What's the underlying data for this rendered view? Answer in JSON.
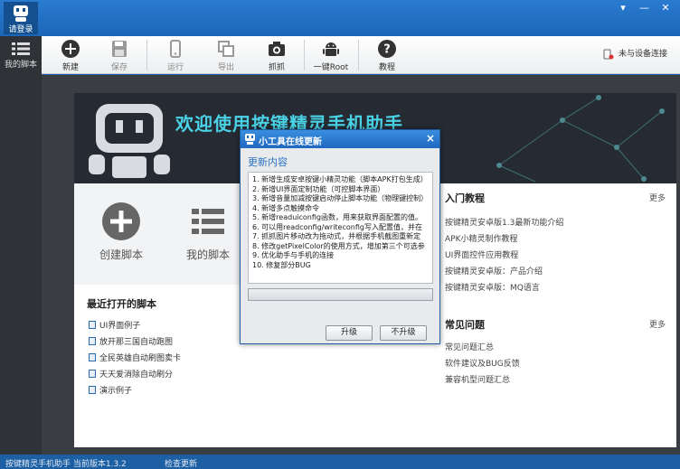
{
  "titlebar": {
    "login_label": "请登录",
    "minimize": "▾",
    "min2": "—",
    "close": "✕"
  },
  "sidebar": {
    "scripts_label": "我的脚本"
  },
  "toolbar": {
    "new": "新建",
    "save": "保存",
    "run": "运行",
    "export": "导出",
    "capture": "抓抓",
    "root": "一键Root",
    "tutorial": "教程",
    "device_status": "未与设备连接"
  },
  "banner": {
    "welcome": "欢迎使用按键精灵手机助手"
  },
  "actions": {
    "create": "创建脚本",
    "mine": "我的脚本"
  },
  "recent": {
    "title": "最近打开的脚本",
    "items": [
      "UI界面例子",
      "放开那三国自动跑图",
      "全民英雄自动刷图卖卡",
      "天天爱消除自动刷分",
      "演示例子"
    ]
  },
  "guide": {
    "title": "入门教程",
    "more": "更多",
    "links": [
      "按键精灵安卓版1.3最新功能介绍",
      "APK小精灵制作教程",
      "UI界面控件应用教程",
      "按键精灵安卓版：产品介绍",
      "按键精灵安卓版：MQ语言"
    ]
  },
  "faq": {
    "title": "常见问题",
    "more": "更多",
    "links": [
      "常见问题汇总",
      "软件建议及BUG反馈",
      "兼容机型问题汇总"
    ]
  },
  "dialog": {
    "title": "小工具在线更新",
    "close": "×",
    "heading": "更新内容",
    "items": [
      "1. 新增生成安卓按键小精灵功能（脚本APK打包生成）",
      "2. 新增UI界面定制功能（可控脚本界面）",
      "3. 新增音量加减按键启动停止脚本功能（物理键控制）",
      "4. 新增多点触摸命令",
      "5. 新增readuiconfig函数，用来获取界面配置的值。",
      "6. 可以用readconfig/writeconfig写入配置值，并在",
      "7. 抓抓图片移动改为拖动式，并根据手机截图重新定",
      "8. 修改getPixelColor的使用方式，增加第三个可选参",
      "9. 优化助手与手机的连接",
      "10. 修复部分BUG"
    ],
    "progress": 0,
    "upgrade": "升级",
    "noupgrade": "不升级"
  },
  "status": {
    "product": "按键精灵手机助手 当前版本1.3.2",
    "check": "检查更新"
  },
  "colors": {
    "brand_blue": "#1d5fa3",
    "cyan_text": "#4ad2e6",
    "link_blue": "#2b73c4"
  }
}
